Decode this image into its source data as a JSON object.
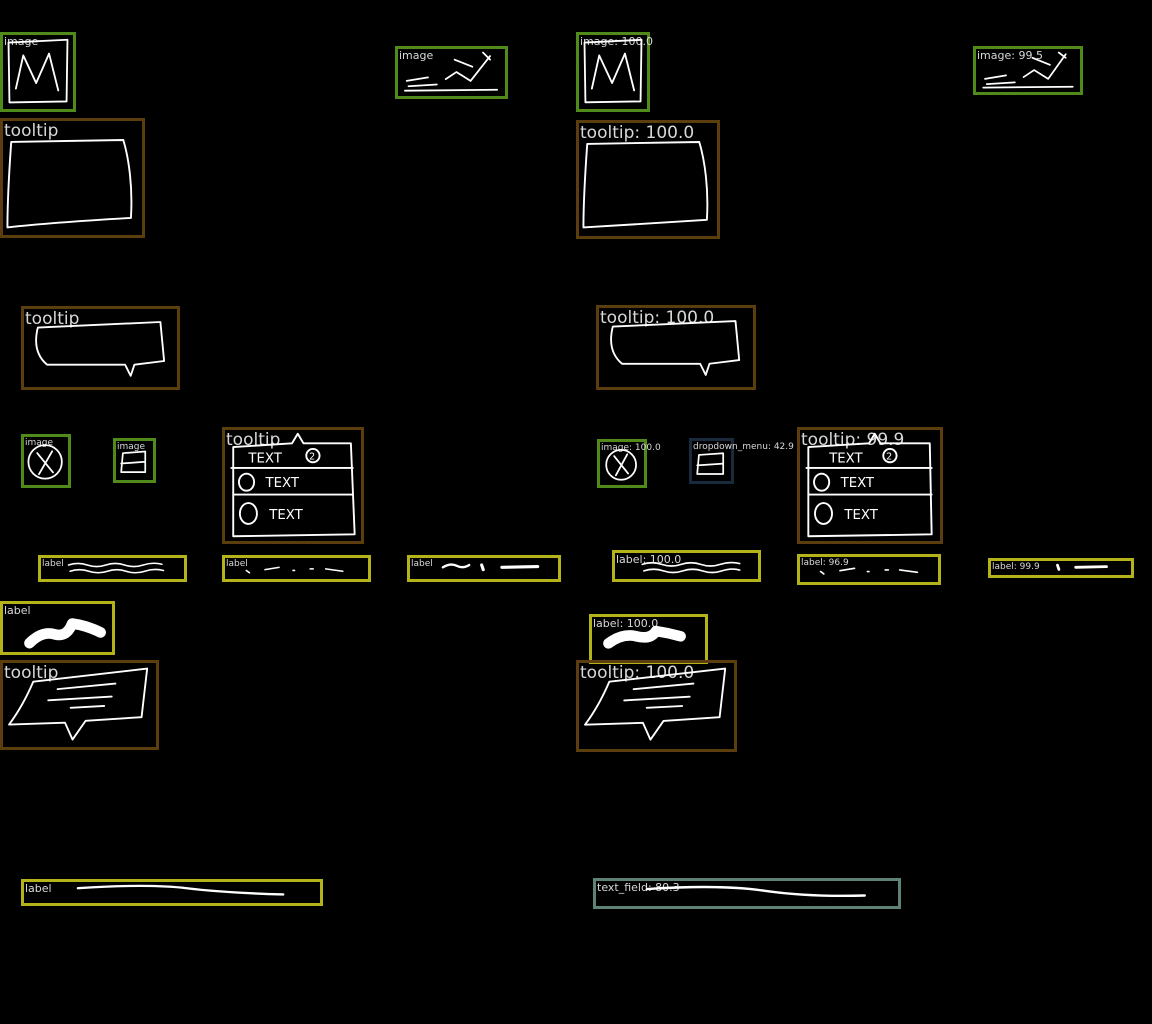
{
  "panels": {
    "left": {
      "boxes": [
        {
          "label": "image"
        },
        {
          "label": "image"
        },
        {
          "label": "tooltip"
        },
        {
          "label": "tooltip"
        },
        {
          "label": "image"
        },
        {
          "label": "image"
        },
        {
          "label": "tooltip"
        },
        {
          "label": "label"
        },
        {
          "label": "label"
        },
        {
          "label": "label"
        },
        {
          "label": "label"
        },
        {
          "label": "tooltip"
        },
        {
          "label": "label"
        }
      ]
    },
    "right": {
      "boxes": [
        {
          "label": "image: 100.0"
        },
        {
          "label": "image: 99.5"
        },
        {
          "label": "tooltip: 100.0"
        },
        {
          "label": "tooltip: 100.0"
        },
        {
          "label": "image: 100.0"
        },
        {
          "label": "dropdown_menu: 42.9"
        },
        {
          "label": "tooltip: 99.9"
        },
        {
          "label": "label: 100.0"
        },
        {
          "label": "label: 96.9"
        },
        {
          "label": "label: 99.9"
        },
        {
          "label": "label: 100.0"
        },
        {
          "label": "tooltip: 100.0"
        },
        {
          "label": "text_field: 80.3"
        }
      ]
    }
  },
  "sketch_text": {
    "text": "TEXT",
    "badge": "2"
  },
  "colors": {
    "image": "#4f8a1a",
    "tooltip": "#5c3d0e",
    "label": "#b5b31a",
    "dropdown_menu": "#1a2a3d",
    "text_field": "#5e8274",
    "background": "#000000",
    "sketch": "#ffffff"
  }
}
